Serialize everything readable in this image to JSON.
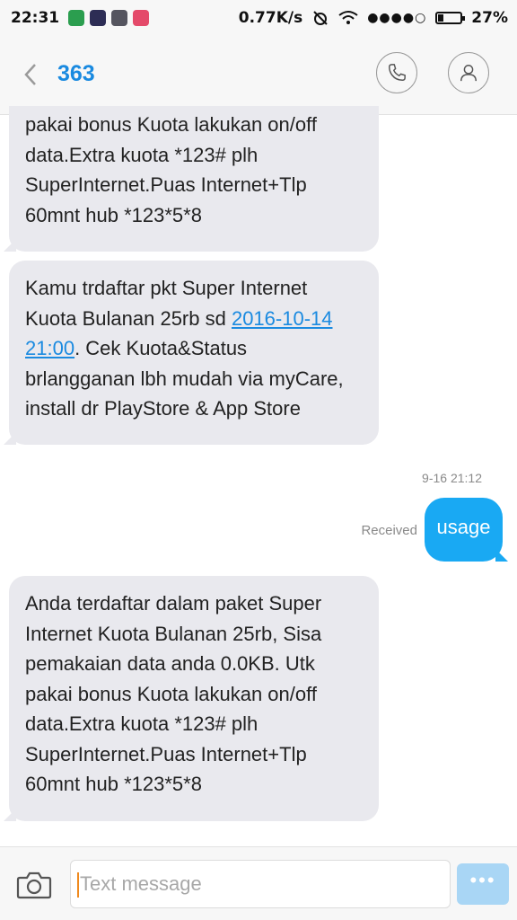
{
  "status_bar": {
    "time": "22:31",
    "network_speed": "0.77K/s",
    "battery": "27%",
    "battery_level": 0.27,
    "app_icons": [
      "maps-icon",
      "blackberry-icon",
      "shield-app-icon",
      "music-icon"
    ],
    "app_colors": [
      "#2b9e4f",
      "#2d2d55",
      "#55555f",
      "#e44a6a"
    ]
  },
  "header": {
    "title": "363",
    "accent_color": "#1a8ae0"
  },
  "messages": {
    "m1": {
      "lines": [
        "pakai bonus Kuota lakukan on/off",
        "data.Extra kuota *123# plh",
        "SuperInternet.Puas Internet+Tlp",
        "60mnt hub *123*5*8"
      ]
    },
    "m2": {
      "line1": "Kamu trdaftar pkt Super Internet",
      "line2_prefix": "Kuota Bulanan 25rb sd ",
      "link_date": "2016-10-14",
      "link_time": "21:00",
      "line3_suffix": ". Cek Kuota&Status",
      "line4": "brlangganan lbh mudah via myCare,",
      "line5": "install dr PlayStore & App Store"
    },
    "sent": {
      "timestamp": "9-16 21:12",
      "status": "Received",
      "text": "usage",
      "color": "#19a9f3"
    },
    "m4": {
      "lines": [
        "Anda terdaftar dalam paket Super",
        "Internet Kuota Bulanan 25rb, Sisa",
        "pemakaian data anda 0.0KB. Utk",
        "pakai bonus Kuota lakukan on/off",
        "data.Extra kuota *123# plh",
        "SuperInternet.Puas Internet+Tlp",
        "60mnt hub *123*5*8"
      ]
    }
  },
  "composer": {
    "placeholder": "Text message",
    "send_label": "•••"
  }
}
